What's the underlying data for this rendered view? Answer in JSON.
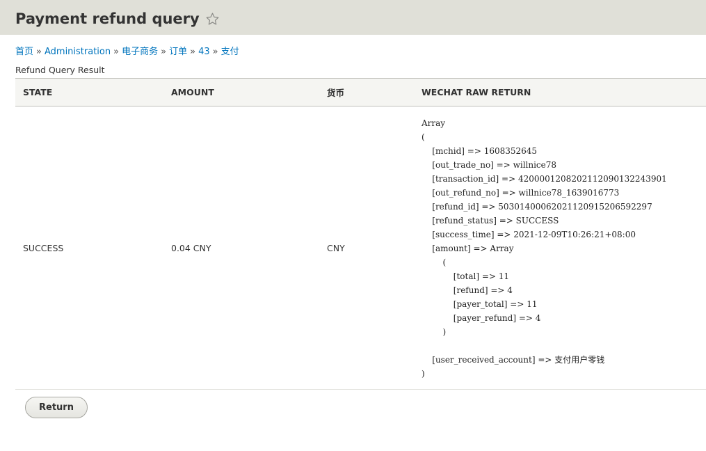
{
  "page": {
    "title": "Payment refund query"
  },
  "breadcrumb": [
    {
      "label": "首页"
    },
    {
      "label": "Administration"
    },
    {
      "label": "电子商务"
    },
    {
      "label": "订单"
    },
    {
      "label": "43"
    },
    {
      "label": "支付"
    }
  ],
  "breadcrumb_separator": "»",
  "result": {
    "caption": "Refund Query Result",
    "headers": {
      "state": "STATE",
      "amount": "AMOUNT",
      "currency": "货币",
      "raw": "WECHAT RAW RETURN"
    },
    "row": {
      "state": "SUCCESS",
      "amount": "0.04 CNY",
      "currency": "CNY",
      "raw_return": "Array\n(\n    [mchid] => 1608352645\n    [out_trade_no] => willnice78\n    [transaction_id] => 4200001208202112090132243901\n    [out_refund_no] => willnice78_1639016773\n    [refund_id] => 50301400062021120915206592297\n    [refund_status] => SUCCESS\n    [success_time] => 2021-12-09T10:26:21+08:00\n    [amount] => Array\n        (\n            [total] => 11\n            [refund] => 4\n            [payer_total] => 11\n            [payer_refund] => 4\n        )\n\n    [user_received_account] => 支付用户零钱\n)"
    }
  },
  "actions": {
    "return_label": "Return"
  },
  "icons": {
    "favorite": "star-outline-icon"
  },
  "colors": {
    "header_bg": "#e0e0d8",
    "link": "#0074bd",
    "table_head_bg": "#f5f5f2"
  }
}
